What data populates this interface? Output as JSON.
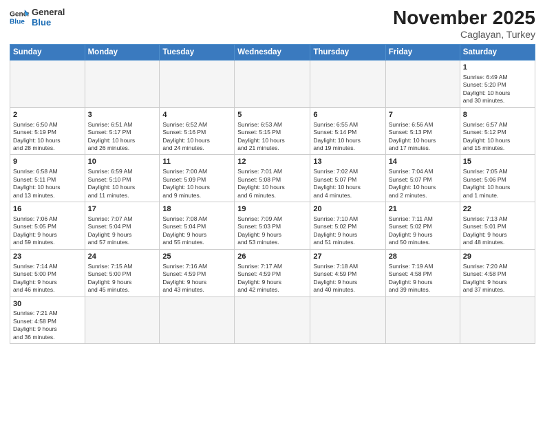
{
  "header": {
    "logo_general": "General",
    "logo_blue": "Blue",
    "main_title": "November 2025",
    "sub_title": "Caglayan, Turkey"
  },
  "weekdays": [
    "Sunday",
    "Monday",
    "Tuesday",
    "Wednesday",
    "Thursday",
    "Friday",
    "Saturday"
  ],
  "weeks": [
    [
      {
        "day": "",
        "info": ""
      },
      {
        "day": "",
        "info": ""
      },
      {
        "day": "",
        "info": ""
      },
      {
        "day": "",
        "info": ""
      },
      {
        "day": "",
        "info": ""
      },
      {
        "day": "",
        "info": ""
      },
      {
        "day": "1",
        "info": "Sunrise: 6:49 AM\nSunset: 5:20 PM\nDaylight: 10 hours\nand 30 minutes."
      }
    ],
    [
      {
        "day": "2",
        "info": "Sunrise: 6:50 AM\nSunset: 5:19 PM\nDaylight: 10 hours\nand 28 minutes."
      },
      {
        "day": "3",
        "info": "Sunrise: 6:51 AM\nSunset: 5:17 PM\nDaylight: 10 hours\nand 26 minutes."
      },
      {
        "day": "4",
        "info": "Sunrise: 6:52 AM\nSunset: 5:16 PM\nDaylight: 10 hours\nand 24 minutes."
      },
      {
        "day": "5",
        "info": "Sunrise: 6:53 AM\nSunset: 5:15 PM\nDaylight: 10 hours\nand 21 minutes."
      },
      {
        "day": "6",
        "info": "Sunrise: 6:55 AM\nSunset: 5:14 PM\nDaylight: 10 hours\nand 19 minutes."
      },
      {
        "day": "7",
        "info": "Sunrise: 6:56 AM\nSunset: 5:13 PM\nDaylight: 10 hours\nand 17 minutes."
      },
      {
        "day": "8",
        "info": "Sunrise: 6:57 AM\nSunset: 5:12 PM\nDaylight: 10 hours\nand 15 minutes."
      }
    ],
    [
      {
        "day": "9",
        "info": "Sunrise: 6:58 AM\nSunset: 5:11 PM\nDaylight: 10 hours\nand 13 minutes."
      },
      {
        "day": "10",
        "info": "Sunrise: 6:59 AM\nSunset: 5:10 PM\nDaylight: 10 hours\nand 11 minutes."
      },
      {
        "day": "11",
        "info": "Sunrise: 7:00 AM\nSunset: 5:09 PM\nDaylight: 10 hours\nand 9 minutes."
      },
      {
        "day": "12",
        "info": "Sunrise: 7:01 AM\nSunset: 5:08 PM\nDaylight: 10 hours\nand 6 minutes."
      },
      {
        "day": "13",
        "info": "Sunrise: 7:02 AM\nSunset: 5:07 PM\nDaylight: 10 hours\nand 4 minutes."
      },
      {
        "day": "14",
        "info": "Sunrise: 7:04 AM\nSunset: 5:07 PM\nDaylight: 10 hours\nand 2 minutes."
      },
      {
        "day": "15",
        "info": "Sunrise: 7:05 AM\nSunset: 5:06 PM\nDaylight: 10 hours\nand 1 minute."
      }
    ],
    [
      {
        "day": "16",
        "info": "Sunrise: 7:06 AM\nSunset: 5:05 PM\nDaylight: 9 hours\nand 59 minutes."
      },
      {
        "day": "17",
        "info": "Sunrise: 7:07 AM\nSunset: 5:04 PM\nDaylight: 9 hours\nand 57 minutes."
      },
      {
        "day": "18",
        "info": "Sunrise: 7:08 AM\nSunset: 5:04 PM\nDaylight: 9 hours\nand 55 minutes."
      },
      {
        "day": "19",
        "info": "Sunrise: 7:09 AM\nSunset: 5:03 PM\nDaylight: 9 hours\nand 53 minutes."
      },
      {
        "day": "20",
        "info": "Sunrise: 7:10 AM\nSunset: 5:02 PM\nDaylight: 9 hours\nand 51 minutes."
      },
      {
        "day": "21",
        "info": "Sunrise: 7:11 AM\nSunset: 5:02 PM\nDaylight: 9 hours\nand 50 minutes."
      },
      {
        "day": "22",
        "info": "Sunrise: 7:13 AM\nSunset: 5:01 PM\nDaylight: 9 hours\nand 48 minutes."
      }
    ],
    [
      {
        "day": "23",
        "info": "Sunrise: 7:14 AM\nSunset: 5:00 PM\nDaylight: 9 hours\nand 46 minutes."
      },
      {
        "day": "24",
        "info": "Sunrise: 7:15 AM\nSunset: 5:00 PM\nDaylight: 9 hours\nand 45 minutes."
      },
      {
        "day": "25",
        "info": "Sunrise: 7:16 AM\nSunset: 4:59 PM\nDaylight: 9 hours\nand 43 minutes."
      },
      {
        "day": "26",
        "info": "Sunrise: 7:17 AM\nSunset: 4:59 PM\nDaylight: 9 hours\nand 42 minutes."
      },
      {
        "day": "27",
        "info": "Sunrise: 7:18 AM\nSunset: 4:59 PM\nDaylight: 9 hours\nand 40 minutes."
      },
      {
        "day": "28",
        "info": "Sunrise: 7:19 AM\nSunset: 4:58 PM\nDaylight: 9 hours\nand 39 minutes."
      },
      {
        "day": "29",
        "info": "Sunrise: 7:20 AM\nSunset: 4:58 PM\nDaylight: 9 hours\nand 37 minutes."
      }
    ],
    [
      {
        "day": "30",
        "info": "Sunrise: 7:21 AM\nSunset: 4:58 PM\nDaylight: 9 hours\nand 36 minutes."
      },
      {
        "day": "",
        "info": ""
      },
      {
        "day": "",
        "info": ""
      },
      {
        "day": "",
        "info": ""
      },
      {
        "day": "",
        "info": ""
      },
      {
        "day": "",
        "info": ""
      },
      {
        "day": "",
        "info": ""
      }
    ]
  ]
}
